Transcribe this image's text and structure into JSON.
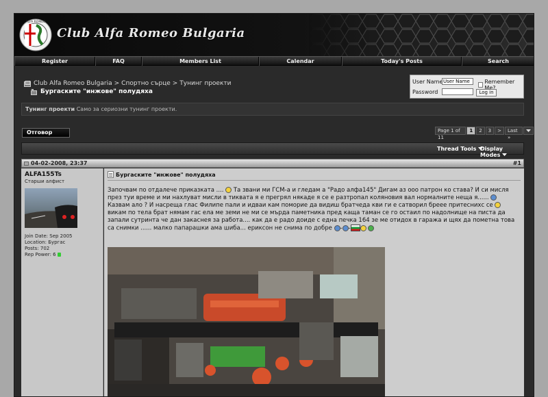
{
  "site": {
    "title": "Club Alfa Romeo Bulgaria",
    "logo_text": "ALFA ROMEO"
  },
  "navbar": [
    "Register",
    "FAQ",
    "Members List",
    "Calendar",
    "Today's Posts",
    "Search"
  ],
  "breadcrumb": {
    "items": [
      "Club Alfa Romeo Bulgaria",
      "Спортно сърце",
      "Тунинг проекти"
    ],
    "separator": ">",
    "thread_title": "Бургаските \"инжове\" полудяха"
  },
  "login": {
    "username_label": "User Name",
    "username_value": "User Name",
    "password_label": "Password",
    "remember_label": "Remember Me?",
    "button_label": "Log in"
  },
  "forum": {
    "name": "Тунинг проекти",
    "description": "Само за сериозни тунинг проекти."
  },
  "reply_button": "Отговор",
  "pagination": {
    "label": "Page 1 of 11",
    "pages": [
      "1",
      "2",
      "3"
    ],
    "current": "1",
    "next": ">",
    "last": "Last »"
  },
  "tools": {
    "thread_tools": "Thread Tools",
    "display_modes": "Display Modes"
  },
  "post": {
    "date": "04-02-2008, 23:37",
    "number": "#1",
    "title": "Бургаските \"инжове\" полудяха",
    "author": {
      "username": "ALFA155Ts",
      "user_title": "Старши алфист",
      "join_date": "Join Date: Sep 2005",
      "location": "Location: Бургас",
      "posts": "Posts: 702",
      "rep_power": "Rep Power: 6"
    },
    "text": {
      "p1": "Започвам по отдалече приказката .... ",
      "p2": " Та звани ми ГСМ-а и гледам а \"Радо алфа145\" Дигам аз ооо патрон ко става? И си мисля през туи време и ми нахлуват мисли в тиквата я е прегрял някаде я се е разтропал коляновия вал нормалните неща я...... ",
      "p3": " Казвам ало ? И насреща глас Филипе пали и идваи кам поморие да видиш братчеда кви ги е сатворил брееe притеснихс се ",
      "p4": " викам по тела брат нямам гас ела ме земи не ми се мърда паметника пред каща таман се го остаил по надолнище на писта да запали сутринта че дан закаснея за работа.... как да е радо доиде с една печка 164 зе ме отидох в гаража и щях да пометна това са снимки ...... малко папарашки ама шиба... ериксон не снима по добре "
    }
  },
  "colors": {
    "flag": [
      "#ffffff",
      "#1a9b3c",
      "#d21c1c"
    ],
    "rep_dot": "#33cc33"
  }
}
